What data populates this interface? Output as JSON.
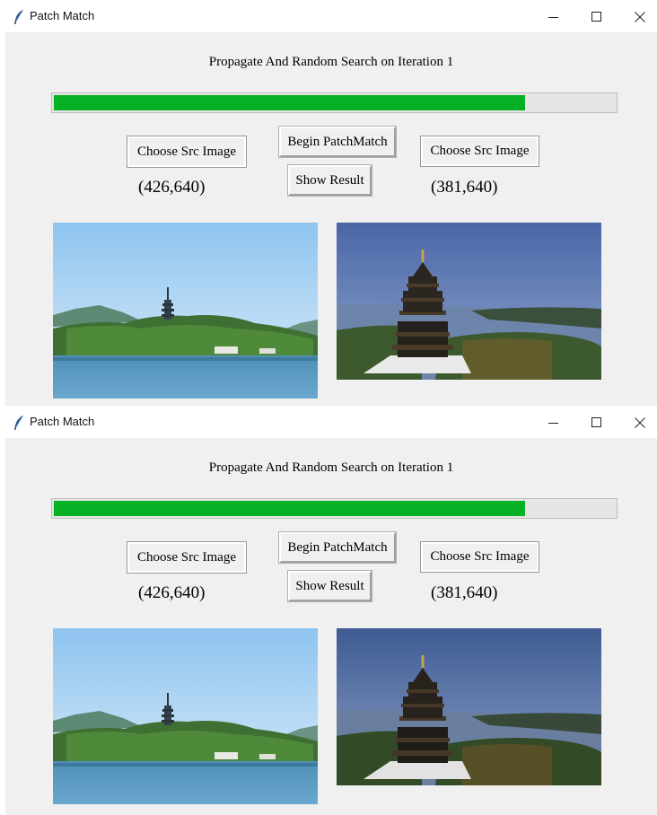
{
  "windows": [
    {
      "title": "Patch Match",
      "status": "Propagate And Random Search on Iteration 1",
      "progress": 0.84,
      "buttons": {
        "choose_left": "Choose Src Image",
        "begin": "Begin PatchMatch",
        "show": "Show Result",
        "choose_right": "Choose Src Image"
      },
      "left_dims": "(426,640)",
      "right_dims": "(381,640)"
    },
    {
      "title": "Patch Match",
      "status": "Propagate And Random Search on Iteration 1",
      "progress": 0.84,
      "buttons": {
        "choose_left": "Choose Src Image",
        "begin": "Begin PatchMatch",
        "show": "Show Result",
        "choose_right": "Choose Src Image"
      },
      "left_dims": "(426,640)",
      "right_dims": "(381,640)"
    }
  ],
  "icons": {
    "app": "feather-icon",
    "minimize": "minimize-icon",
    "maximize": "maximize-icon",
    "close": "close-icon"
  },
  "colors": {
    "progress_fill": "#06b025",
    "progress_track": "#e6e6e6",
    "client_bg": "#f0f0f0"
  }
}
